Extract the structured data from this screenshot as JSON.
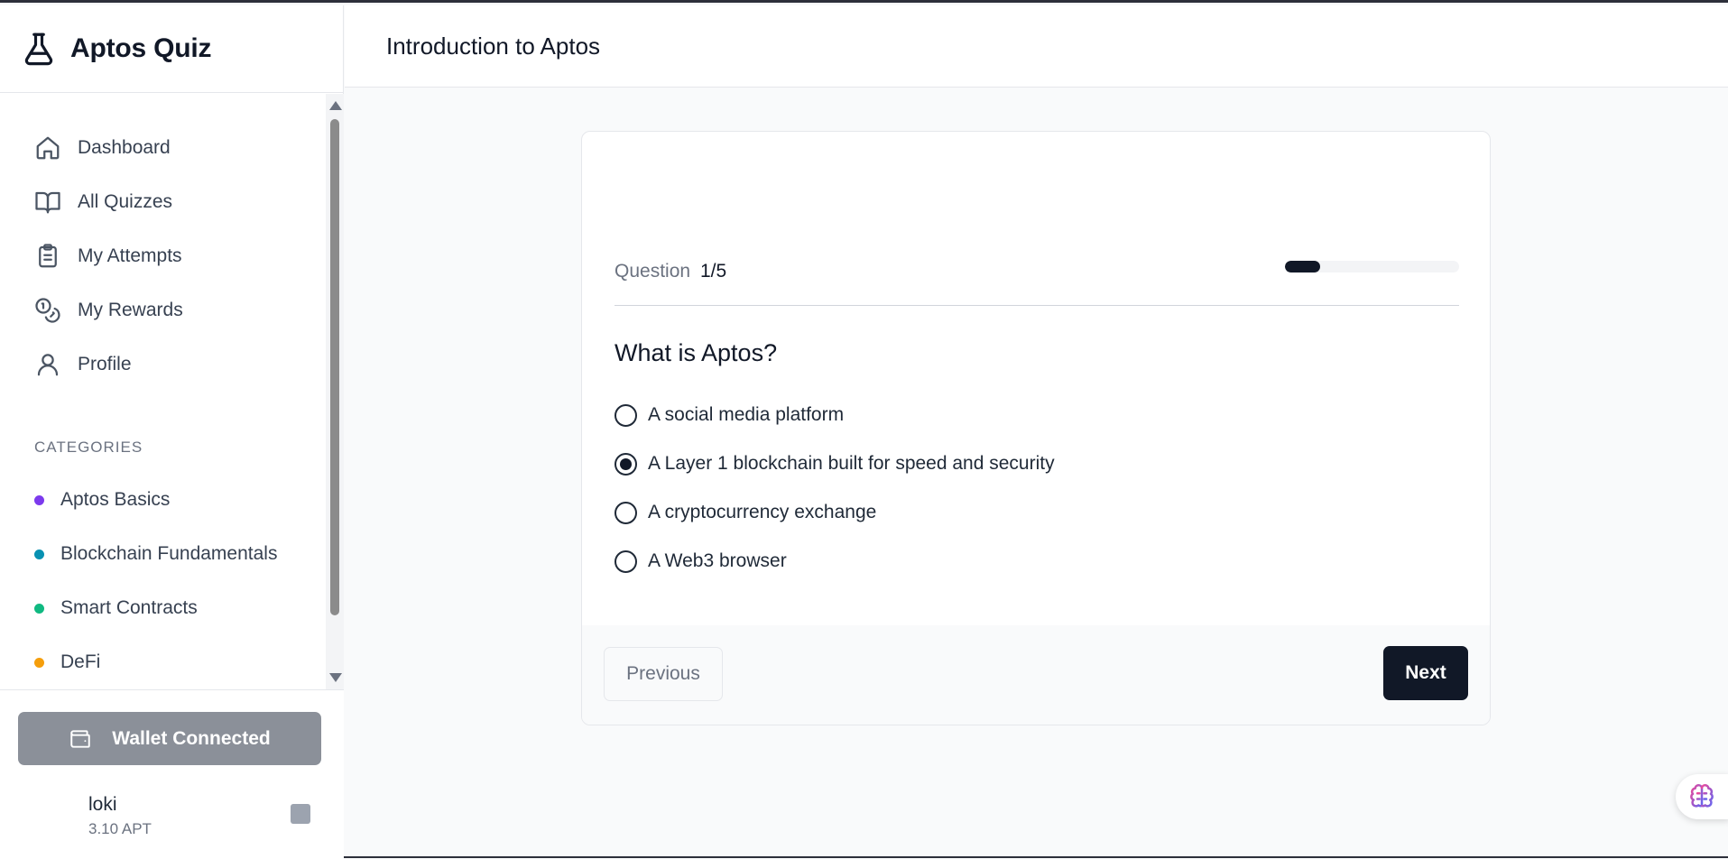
{
  "brand": {
    "name": "Aptos Quiz",
    "icon": "flask-icon"
  },
  "nav": [
    {
      "label": "Dashboard",
      "icon": "home-icon"
    },
    {
      "label": "All Quizzes",
      "icon": "book-icon"
    },
    {
      "label": "My Attempts",
      "icon": "clipboard-icon"
    },
    {
      "label": "My Rewards",
      "icon": "coins-icon"
    },
    {
      "label": "Profile",
      "icon": "user-icon"
    }
  ],
  "categories": {
    "title": "CATEGORIES",
    "items": [
      {
        "label": "Aptos Basics",
        "color": "#7c3aed"
      },
      {
        "label": "Blockchain Fundamentals",
        "color": "#0891b2"
      },
      {
        "label": "Smart Contracts",
        "color": "#10b981"
      },
      {
        "label": "DeFi",
        "color": "#f59e0b"
      }
    ]
  },
  "wallet": {
    "button_label": "Wallet Connected",
    "user_name": "loki",
    "balance": "3.10 APT"
  },
  "header": {
    "title": "Introduction to Aptos"
  },
  "quiz": {
    "question_label": "Question",
    "question_count": "1/5",
    "progress": 0.2,
    "question": "What is Aptos?",
    "options": [
      "A social media platform",
      "A Layer 1 blockchain built for speed and security",
      "A cryptocurrency exchange",
      "A Web3 browser"
    ],
    "selected_index": 1,
    "prev_label": "Previous",
    "next_label": "Next"
  },
  "colors": {
    "accent": "#111827",
    "wallet_button": "#8b9099"
  }
}
